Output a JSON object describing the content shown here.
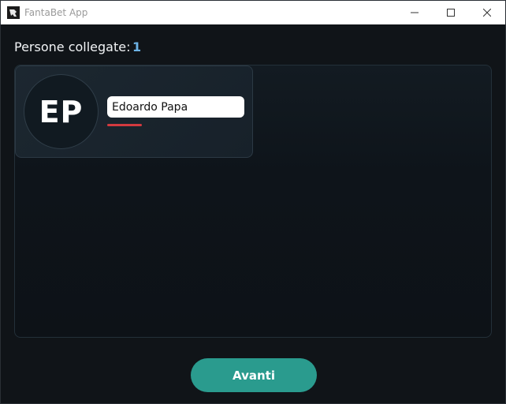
{
  "window": {
    "title": "FantaBet App",
    "app_icon": "fantabet-logo-icon",
    "controls": [
      "minimize-icon",
      "maximize-icon",
      "close-icon"
    ]
  },
  "header": {
    "connected_label": "Persone collegate:",
    "connected_count": "1"
  },
  "users": [
    {
      "initials": "EP",
      "name": "Edoardo Papa",
      "indicator_color": "#d33a3f"
    }
  ],
  "footer": {
    "next_label": "Avanti"
  },
  "colors": {
    "accent": "#2a9b8e",
    "count": "#6db3e6",
    "background": "#101418"
  }
}
